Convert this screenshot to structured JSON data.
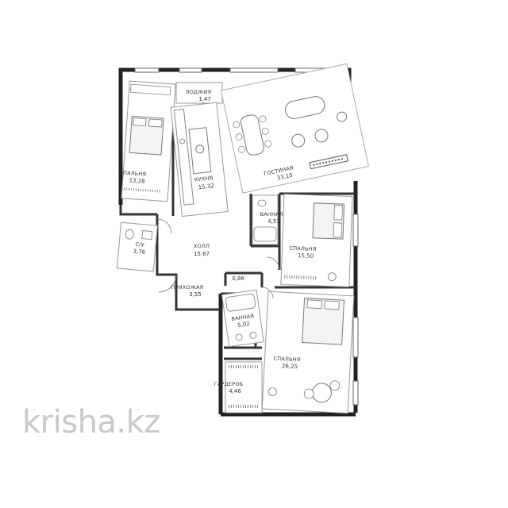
{
  "watermark": "krisha.kz",
  "rooms": {
    "loggia": {
      "name": "ЛОДЖИЯ",
      "area": "1,47"
    },
    "bedroom1": {
      "name": "СПАЛЬНЯ",
      "area": "13,28"
    },
    "kitchen": {
      "name": "КУХНЯ",
      "area": "15,32"
    },
    "living": {
      "name": "ГОСТИНАЯ",
      "area": "33,10"
    },
    "bath1": {
      "name": "ВАННАЯ",
      "area": "4,51"
    },
    "bedroom2": {
      "name": "СПАЛЬНЯ",
      "area": "15,50"
    },
    "wc": {
      "name": "С/У",
      "area": "3,76"
    },
    "hall": {
      "name": "ХОЛЛ",
      "area": "15,67"
    },
    "storage": {
      "name": "",
      "area": "0,86"
    },
    "entry": {
      "name": "ПРИХОЖАЯ",
      "area": "3,55"
    },
    "bath2": {
      "name": "ВАННАЯ",
      "area": "5,02"
    },
    "bedroom3": {
      "name": "СПАЛЬНЯ",
      "area": "26,25"
    },
    "wardrobe": {
      "name": "ГАРДЕРОБ",
      "area": "4,46"
    }
  }
}
